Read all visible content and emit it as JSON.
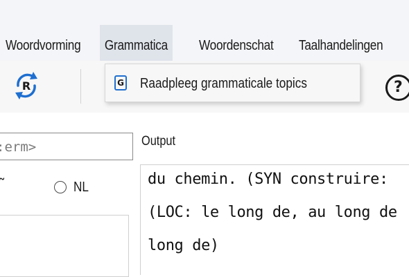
{
  "menu": {
    "items": [
      "Woordvorming",
      "Grammatica",
      "Woordenschat",
      "Taalhandelingen"
    ],
    "active": "Grammatica"
  },
  "dropdown": {
    "items": [
      {
        "icon": "G",
        "label": "Raadpleeg grammaticale topics"
      }
    ]
  },
  "toolbar": {
    "refresh_icon_letter": "R",
    "help_icon_letter": "?"
  },
  "search": {
    "value": ":erm>"
  },
  "options": {
    "left_partial": "̃",
    "radio_nl_label": "NL",
    "radio_nl_selected": false
  },
  "output": {
    "label": "Output",
    "lines": [
      "du chemin. (SYN construire:",
      "(LOC: le long de, au long de",
      "long de)"
    ]
  },
  "colors": {
    "menubar_bg": "#f4f5f8",
    "active_menu_bg": "#dfe3ea",
    "toolbar_bg": "#f7f7f7",
    "icon_blue": "#1e6fd0"
  }
}
